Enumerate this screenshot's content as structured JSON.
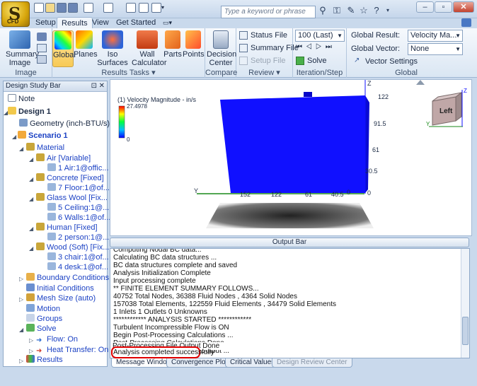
{
  "app": {
    "logo_text": "S",
    "logo_sub": "CFD"
  },
  "ribbon_tabs": [
    {
      "label": "Setup"
    },
    {
      "label": "Results"
    },
    {
      "label": "View"
    },
    {
      "label": "Get Started"
    }
  ],
  "search": {
    "placeholder": "Type a keyword or phrase"
  },
  "groups": {
    "image": "Image",
    "results_tasks": "Results Tasks ▾",
    "compare": "Compare",
    "review": "Review ▾",
    "iteration": "Iteration/Step",
    "global": "Global"
  },
  "buttons": {
    "summary_image": "Summary Image",
    "global": "Global",
    "planes": "Planes",
    "iso_surfaces": "Iso Surfaces",
    "wall_calculator": "Wall Calculator",
    "parts": "Parts",
    "points": "Points",
    "decision_center": "Decision Center",
    "status_file": "Status File",
    "summary_file": "Summary File",
    "setup_file": "Setup File",
    "solve": "Solve",
    "vector_settings": "Vector Settings"
  },
  "iteration": {
    "value": "100 (Last)"
  },
  "global_settings": {
    "result_label": "Global Result:",
    "result_value": "Velocity Ma...",
    "vector_label": "Global Vector:",
    "vector_value": "None"
  },
  "design_study": {
    "title": "Design Study Bar",
    "items": [
      {
        "label": "Note"
      },
      {
        "label": "Design 1"
      },
      {
        "label": "Geometry (inch-BTU/s)"
      },
      {
        "label": "Scenario 1"
      },
      {
        "label": "Material"
      },
      {
        "label": "Air [Variable]"
      },
      {
        "label": "1 Air:1@offic..."
      },
      {
        "label": "Concrete [Fixed]"
      },
      {
        "label": "7 Floor:1@of..."
      },
      {
        "label": "Glass Wool [Fix..."
      },
      {
        "label": "5 Ceiling:1@..."
      },
      {
        "label": "6 Walls:1@of..."
      },
      {
        "label": "Human [Fixed]"
      },
      {
        "label": "2 person:1@..."
      },
      {
        "label": "Wood (Soft) [Fix..."
      },
      {
        "label": "3 chair:1@of..."
      },
      {
        "label": "4 desk:1@of..."
      },
      {
        "label": "Boundary Conditions"
      },
      {
        "label": "Initial Conditions"
      },
      {
        "label": "Mesh Size (auto)"
      },
      {
        "label": "Motion"
      },
      {
        "label": "Groups"
      },
      {
        "label": "Solve"
      },
      {
        "label": "Flow: On"
      },
      {
        "label": "Heat Transfer: On"
      },
      {
        "label": "Results"
      }
    ]
  },
  "viewport": {
    "legend_title": "(1) Velocity Magnitude - in/s",
    "legend_max": "27.4978",
    "legend_min": "0",
    "right_axis": [
      "122",
      "91.5",
      "61",
      "30.5",
      "0"
    ],
    "bottom_axis": [
      "152",
      "122",
      "61",
      "40.5",
      "0"
    ],
    "bottom_axis_y": "0",
    "axis_y_label": "Y",
    "axis_z_label": "Z",
    "viewcube_label": "Left",
    "vc_y": "Y",
    "vc_z": "Z"
  },
  "output_bar": {
    "title": "Output Bar",
    "lines": [
      "Computing Nodal BC data...",
      "Calculating BC data structures ...",
      "BC data structures complete and saved",
      "Analysis Initialization Complete",
      "Input processing complete",
      "** FINITE ELEMENT SUMMARY FOLLOWS...",
      "40752 Total Nodes,    36388 Fluid Nodes ,    4364 Solid Nodes",
      "157038 Total Elements,   122559 Fluid Elements ,   34479 Solid Elements",
      "1 Inlets    1 Outlets    0 Unknowns",
      "************ ANALYSIS STARTED ************",
      "Turbulent Incompressible Flow is ON",
      "Begin Post-Processing Calculations ...",
      "Post-Processing Calculations Done",
      "Begin Post-Processing File Output ...",
      "Post-Processing File Output Done",
      "Analysis completed successfully"
    ],
    "tabs": [
      {
        "label": "Message Window"
      },
      {
        "label": "Convergence Plot"
      },
      {
        "label": "Critical Values"
      },
      {
        "label": "Design Review Center"
      }
    ]
  },
  "colors": {
    "highlight": "#e00000",
    "model_blue": "#1010ff"
  }
}
